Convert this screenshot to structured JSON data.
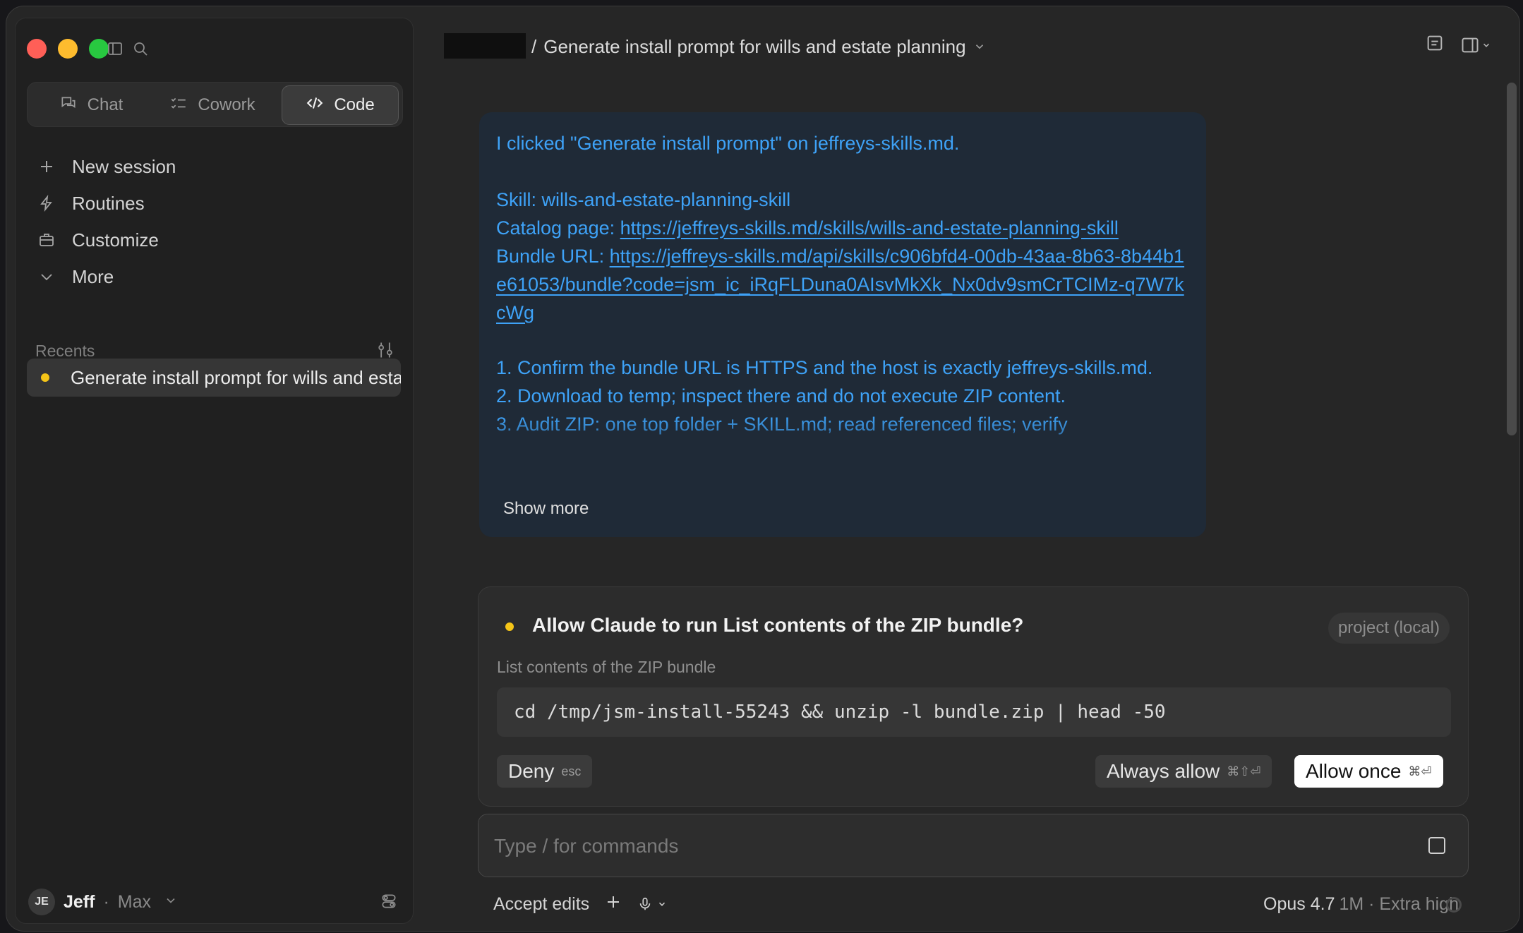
{
  "sidebar": {
    "tabs": [
      {
        "label": "Chat",
        "icon": "chat-icon"
      },
      {
        "label": "Cowork",
        "icon": "checklist-icon"
      },
      {
        "label": "Code",
        "icon": "code-icon"
      }
    ],
    "active_tab": "Code",
    "nav": [
      {
        "label": "New session",
        "icon": "plus-icon"
      },
      {
        "label": "Routines",
        "icon": "bolt-icon"
      },
      {
        "label": "Customize",
        "icon": "briefcase-icon"
      },
      {
        "label": "More",
        "icon": "chevron-down-icon"
      }
    ],
    "recents_label": "Recents",
    "recents": [
      {
        "label": "Generate install prompt for wills and estate planning",
        "status_color": "#f5c518"
      }
    ],
    "user": {
      "initials": "JE",
      "name": "Jeff",
      "separator": "·",
      "plan": "Max"
    }
  },
  "header": {
    "breadcrumb_sep": "/",
    "title": "Generate install prompt for wills and estate planning"
  },
  "message": {
    "line1": "I clicked \"Generate install prompt\" on jeffreys-skills.md.",
    "skill": "Skill: wills-and-estate-planning-skill",
    "catalog_label": "Catalog page: ",
    "catalog_url": "https://jeffreys-skills.md/skills/wills-and-estate-planning-skill",
    "bundle_label": "Bundle URL: ",
    "bundle_url": "https://jeffreys-skills.md/api/skills/c906bfd4-00db-43aa-8b63-8b44b1e61053/bundle?code=jsm_ic_iRqFLDuna0AIsvMkXk_Nx0dv9smCrTCIMz-q7W7kcWg",
    "step1": "1. Confirm the bundle URL is HTTPS and the host is exactly jeffreys-skills.md.",
    "step2": "2. Download to temp; inspect there and do not execute ZIP content.",
    "step3": "3. Audit ZIP: one top folder + SKILL.md; read referenced files; verify",
    "show_more": "Show more"
  },
  "permission": {
    "title": "Allow Claude to run List contents of the ZIP bundle?",
    "scope": "project (local)",
    "subtitle": "List contents of the ZIP bundle",
    "command": "cd /tmp/jsm-install-55243 && unzip -l bundle.zip | head -50",
    "deny_label": "Deny",
    "deny_shortcut": "esc",
    "always_label": "Always allow",
    "always_shortcut": "⌘⇧⏎",
    "once_label": "Allow once",
    "once_shortcut": "⌘⏎"
  },
  "input": {
    "placeholder": "Type / for commands"
  },
  "footer": {
    "accept_edits": "Accept edits",
    "model": "Opus 4.7",
    "model_meta": "1M · Extra high"
  },
  "colors": {
    "accent_link": "#3ea2f7",
    "status_dot": "#f5c518",
    "window_bg": "#262626"
  }
}
